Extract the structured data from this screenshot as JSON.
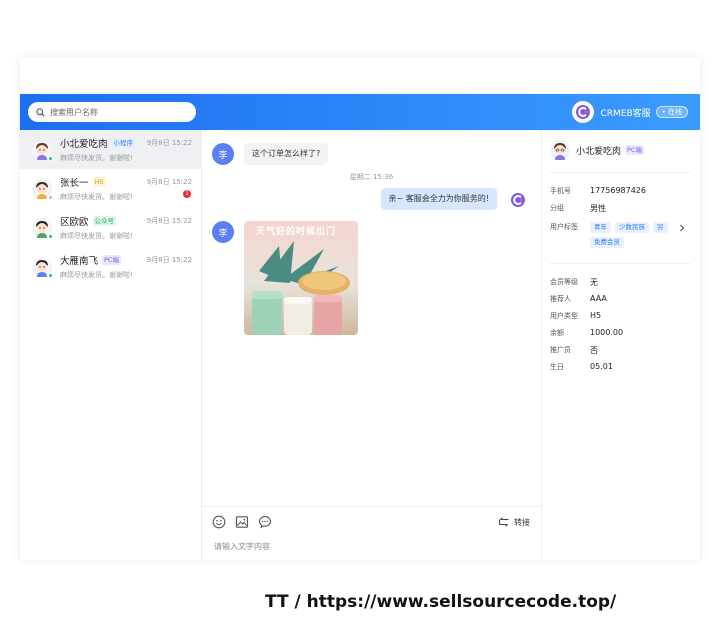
{
  "search": {
    "placeholder": "搜索用户名称"
  },
  "brand": {
    "name": "CRMEB客服",
    "status": "• 在线"
  },
  "chat_list": [
    {
      "name": "小北爱吃肉",
      "tag": "小程序",
      "tag_color": "#2a7cf6",
      "tag_bg": "#e3efff",
      "time": "9月8日 15:22",
      "last_message": "麻烦尽快发货。谢谢啦!",
      "online_color": "#2cc36b",
      "active": true
    },
    {
      "name": "张长一",
      "tag": "H5",
      "tag_color": "#e29a00",
      "tag_bg": "#fff3d8",
      "time": "9月8日 15:22",
      "last_message": "麻烦尽快发货。谢谢啦!",
      "online_color": "#bbbbbb",
      "unread": "1"
    },
    {
      "name": "区欧欧",
      "tag": "公众号",
      "tag_color": "#22a95a",
      "tag_bg": "#e0f6e8",
      "time": "9月8日 15:22",
      "last_message": "麻烦尽快发货。谢谢啦!",
      "online_color": "#2cc36b"
    },
    {
      "name": "大雁南飞",
      "tag": "PC端",
      "tag_color": "#7a5cf0",
      "tag_bg": "#ece6ff",
      "time": "9月8日 15:22",
      "last_message": "麻烦尽快发货。谢谢啦!",
      "online_color": "#2cc36b"
    }
  ],
  "messages": {
    "m1_avatar": "李",
    "m1_text": "这个订单怎么样了?",
    "timestamp": "星期二 15:36",
    "m2_text": "亲~ 客服会全力为你服务的!",
    "m3_avatar": "李",
    "photo_caption": "天气好的时候出门"
  },
  "composer": {
    "transfer_label": "转接",
    "placeholder": "请输入文字内容"
  },
  "profile": {
    "name": "小北爱吃肉",
    "tag": "PC端",
    "phone_label": "手机号",
    "phone": "17756987426",
    "group_label": "分组",
    "group": "男性",
    "user_tags_label": "用户标签",
    "user_tags": [
      "青年",
      "少数民族",
      "穷",
      "免费会员"
    ],
    "member_level_label": "会员等级",
    "member_level": "无",
    "referrer_label": "推荐人",
    "referrer": "AAA",
    "user_type_label": "用户类型",
    "user_type": "H5",
    "balance_label": "余额",
    "balance": "1000.00",
    "promoter_label": "推广员",
    "promoter": "否",
    "birthday_label": "生日",
    "birthday": "05.01"
  },
  "colors": {
    "header_start": "#1c6ff0",
    "header_end": "#3b9cff",
    "accent": "#2a7cf6"
  },
  "watermark": "TT / https://www.sellsourcecode.top/"
}
